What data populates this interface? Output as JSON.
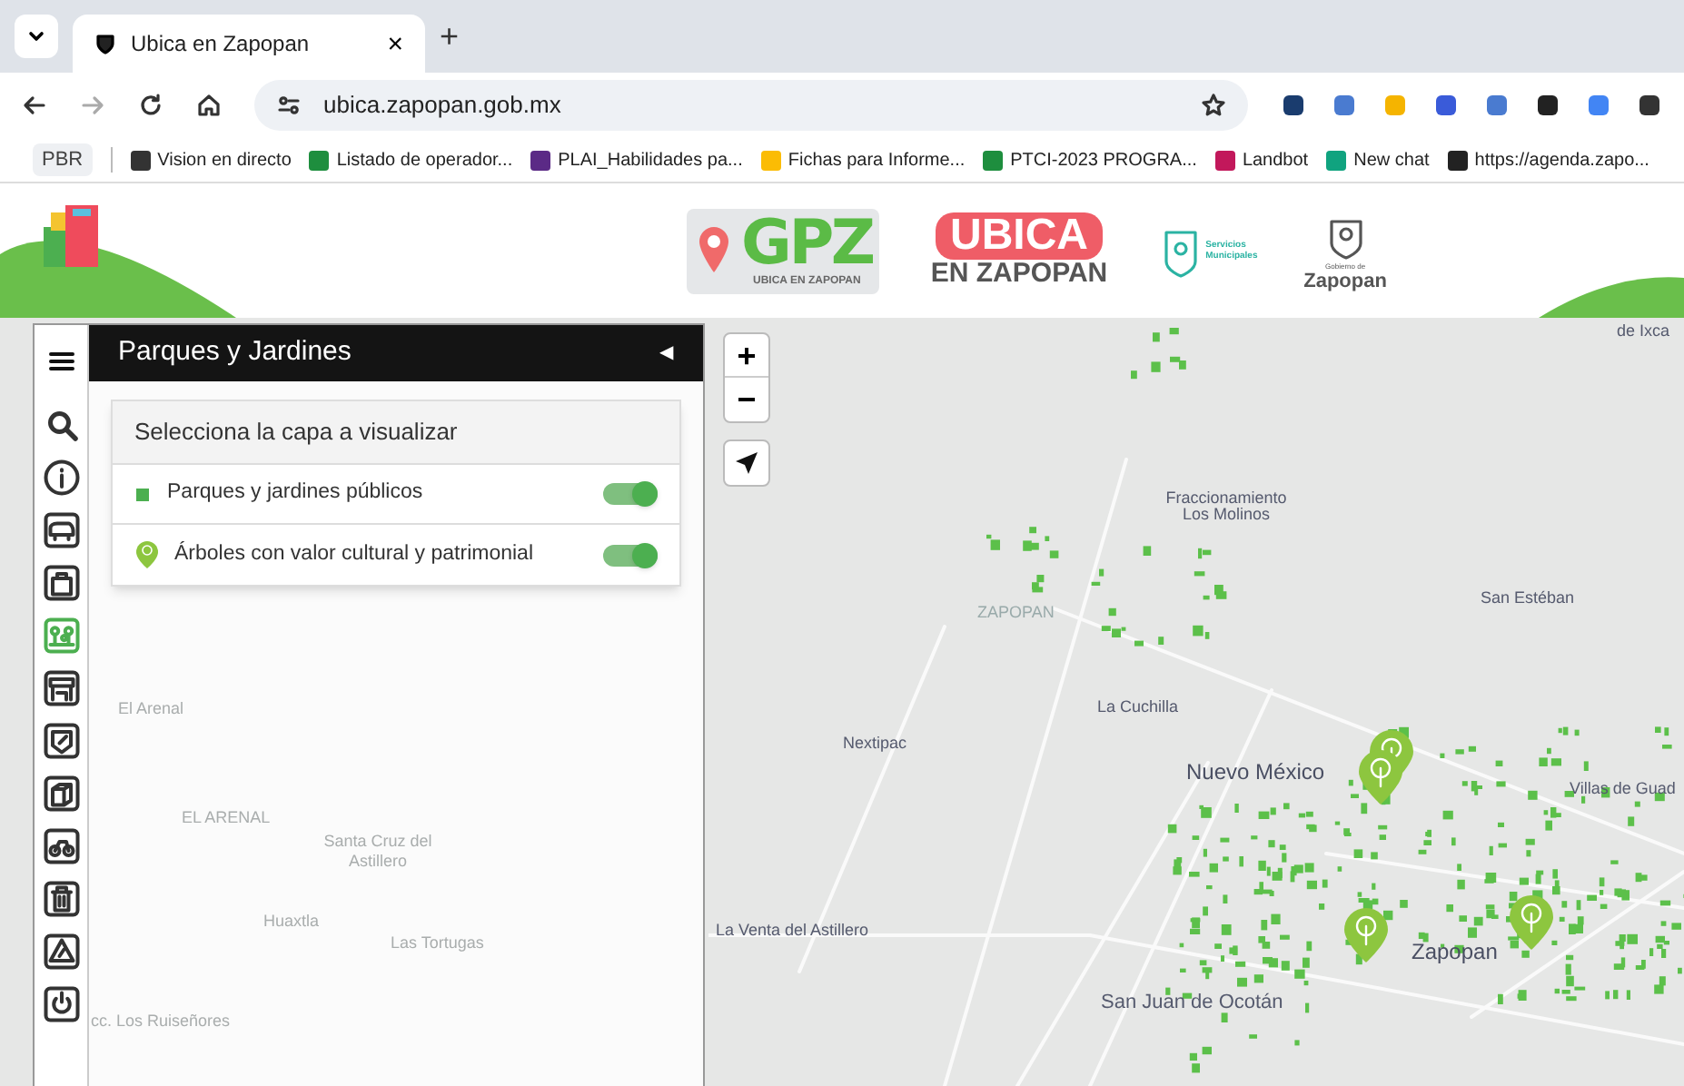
{
  "browser": {
    "tab": {
      "title": "Ubica en Zapopan",
      "close": "×"
    },
    "new_tab": "+",
    "url": "ubica.zapopan.gob.mx",
    "profile": "PBR",
    "bookmarks": [
      {
        "label": "Vision en directo"
      },
      {
        "label": "Listado de operador..."
      },
      {
        "label": "PLAI_Habilidades pa..."
      },
      {
        "label": "Fichas para Informe..."
      },
      {
        "label": "PTCI-2023 PROGRA..."
      },
      {
        "label": "Landbot"
      },
      {
        "label": "New chat"
      },
      {
        "label": "https://agenda.zapo..."
      }
    ]
  },
  "header": {
    "gpz": "GPZ",
    "gpz_sub": "UBICA EN ZAPOPAN",
    "ubica": "UBICA",
    "ubica_sub": "EN ZAPOPAN",
    "servicios": "Servicios Municipales",
    "gobierno_small": "Gobierno de",
    "gobierno": "Zapopan"
  },
  "sidebar": {
    "items": [
      {
        "selected": false
      },
      {
        "selected": false
      },
      {
        "selected": false
      },
      {
        "selected": false
      },
      {
        "selected": true
      },
      {
        "selected": false
      },
      {
        "selected": false
      },
      {
        "selected": false
      },
      {
        "selected": false
      },
      {
        "selected": false
      },
      {
        "selected": false
      },
      {
        "selected": false
      }
    ]
  },
  "panel": {
    "title": "Parques y Jardines",
    "collapse": "◀",
    "card_title": "Selecciona la capa a visualizar",
    "layers": [
      {
        "kind": "square",
        "label": "Parques y jardines públicos",
        "on": true
      },
      {
        "kind": "pin",
        "label": "Árboles con valor cultural y patrimonial",
        "on": true
      }
    ]
  },
  "map": {
    "zoom_in": "+",
    "zoom_out": "−",
    "labels": [
      {
        "text": "de Ixca",
        "kind": "small"
      },
      {
        "text": "Fraccionamiento Los Molinos",
        "kind": "small"
      },
      {
        "text": "ZAPOPAN",
        "kind": "faint"
      },
      {
        "text": "San Estéban",
        "kind": "small"
      },
      {
        "text": "La Cuchilla",
        "kind": "small"
      },
      {
        "text": "Nextipac",
        "kind": "small"
      },
      {
        "text": "Nuevo México",
        "kind": "big"
      },
      {
        "text": "Villas de Guad",
        "kind": "small"
      },
      {
        "text": "La Venta del Astillero",
        "kind": "small"
      },
      {
        "text": "Zapopan",
        "kind": "big"
      },
      {
        "text": "San Juan de Ocotán",
        "kind": "mid"
      }
    ],
    "faded_labels": [
      "El Arenal",
      "EL ARENAL",
      "Santa Cruz del Astillero",
      "Huaxtla",
      "Las Tortugas",
      "cc. Los Ruiseñores"
    ]
  }
}
